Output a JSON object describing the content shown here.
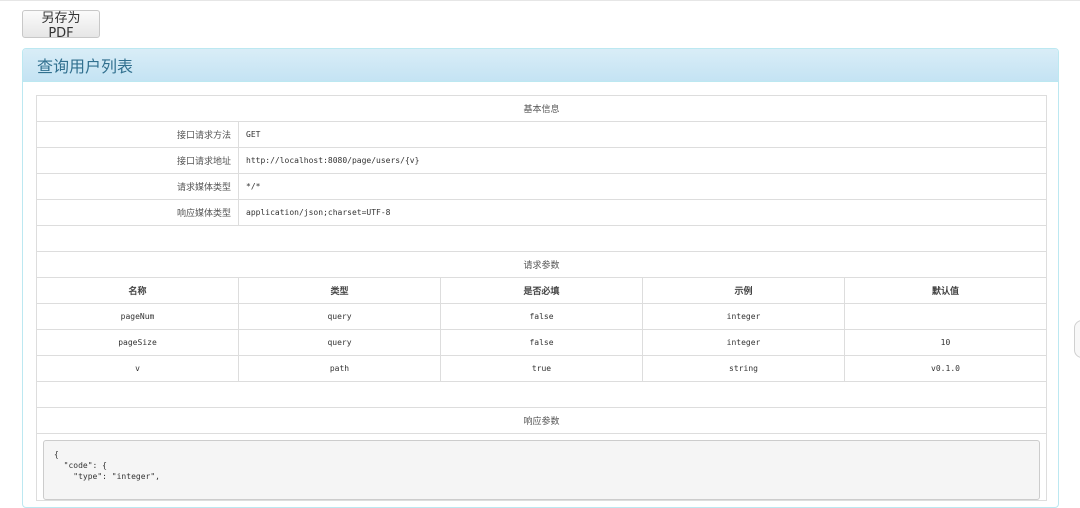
{
  "toolbar": {
    "save_pdf_label": "另存为PDF"
  },
  "panel": {
    "title": "查询用户列表"
  },
  "basic_info": {
    "section_title": "基本信息",
    "rows": [
      {
        "label": "接口请求方法",
        "value": "GET"
      },
      {
        "label": "接口请求地址",
        "value": "http://localhost:8080/page/users/{v}"
      },
      {
        "label": "请求媒体类型",
        "value": "*/*"
      },
      {
        "label": "响应媒体类型",
        "value": "application/json;charset=UTF-8"
      }
    ]
  },
  "request_params": {
    "section_title": "请求参数",
    "columns": [
      "名称",
      "类型",
      "是否必填",
      "示例",
      "默认值"
    ],
    "rows": [
      [
        "pageNum",
        "query",
        "false",
        "integer",
        ""
      ],
      [
        "pageSize",
        "query",
        "false",
        "integer",
        "10"
      ],
      [
        "v",
        "path",
        "true",
        "string",
        "v0.1.0"
      ]
    ]
  },
  "response_params": {
    "section_title": "响应参数",
    "code_lines": "{\n  \"code\": {\n    \"type\": \"integer\","
  }
}
